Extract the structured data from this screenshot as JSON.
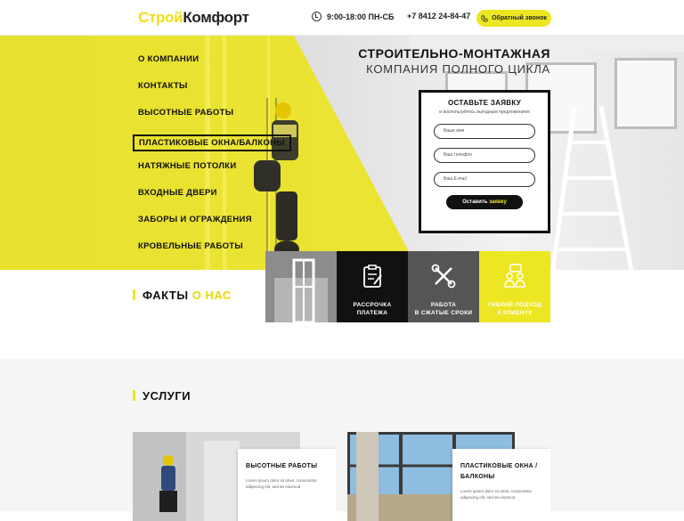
{
  "header": {
    "logo_part1": "Строй",
    "logo_part2": "Комфорт",
    "hours": "9:00-18:00 ПН-СБ",
    "phone": "+7 8412 24-84-47",
    "callback_label": "Обратный звонок"
  },
  "menu": {
    "items": [
      {
        "label": "О КОМПАНИИ"
      },
      {
        "label": "КОНТАКТЫ"
      },
      {
        "label": "ВЫСОТНЫЕ РАБОТЫ"
      },
      {
        "label": "ПЛАСТИКОВЫЕ ОКНА/БАЛКОНЫ",
        "active": true
      },
      {
        "label": "НАТЯЖНЫЕ ПОТОЛКИ"
      },
      {
        "label": "ВХОДНЫЕ ДВЕРИ"
      },
      {
        "label": "ЗАБОРЫ И ОГРАЖДЕНИЯ"
      },
      {
        "label": "КРОВЕЛЬНЫЕ РАБОТЫ"
      }
    ]
  },
  "hero": {
    "title": "СТРОИТЕЛЬНО-МОНТАЖНАЯ",
    "subtitle": "КОМПАНИЯ ПОЛНОГО ЦИКЛА"
  },
  "form": {
    "title": "ОСТАВЬТЕ ЗАЯВКУ",
    "subtitle": "и воспользуйтесь выгодным предложением",
    "name_placeholder": "Ваше имя",
    "phone_placeholder": "Ваш телефон",
    "email_placeholder": "Ваш E-mail",
    "submit_part1": "Оставить",
    "submit_part2": "заявку"
  },
  "facts": {
    "title_part1": "ФАКТЫ",
    "title_part2": "О НАС"
  },
  "tiles": [
    {
      "label1": "",
      "label2": "",
      "icon": "window-photo"
    },
    {
      "label1": "РАССРОЧКА",
      "label2": "ПЛАТЕЖА",
      "icon": "clipboard-icon"
    },
    {
      "label1": "РАБОТА",
      "label2": "В СЖАТЫЕ СРОКИ",
      "icon": "tools-icon"
    },
    {
      "label1": "ГИБКИЙ ПОДХОД",
      "label2": "К КЛИЕНТУ",
      "icon": "people-chat-icon"
    }
  ],
  "services": {
    "title": "УСЛУГИ",
    "cards": [
      {
        "title": "ВЫСОТНЫЕ РАБОТЫ",
        "desc": "Lorem ipsum dolor sit amet, consectetur adipiscing elit, sed do eiusmod"
      },
      {
        "title": "ПЛАСТИКОВЫЕ ОКНА / БАЛКОНЫ",
        "desc": "Lorem ipsum dolor sit amet, consectetur adipiscing elit, sed do eiusmod"
      }
    ]
  },
  "colors": {
    "accent": "#ede623",
    "dark": "#111111",
    "tile_gray": "#555555"
  }
}
